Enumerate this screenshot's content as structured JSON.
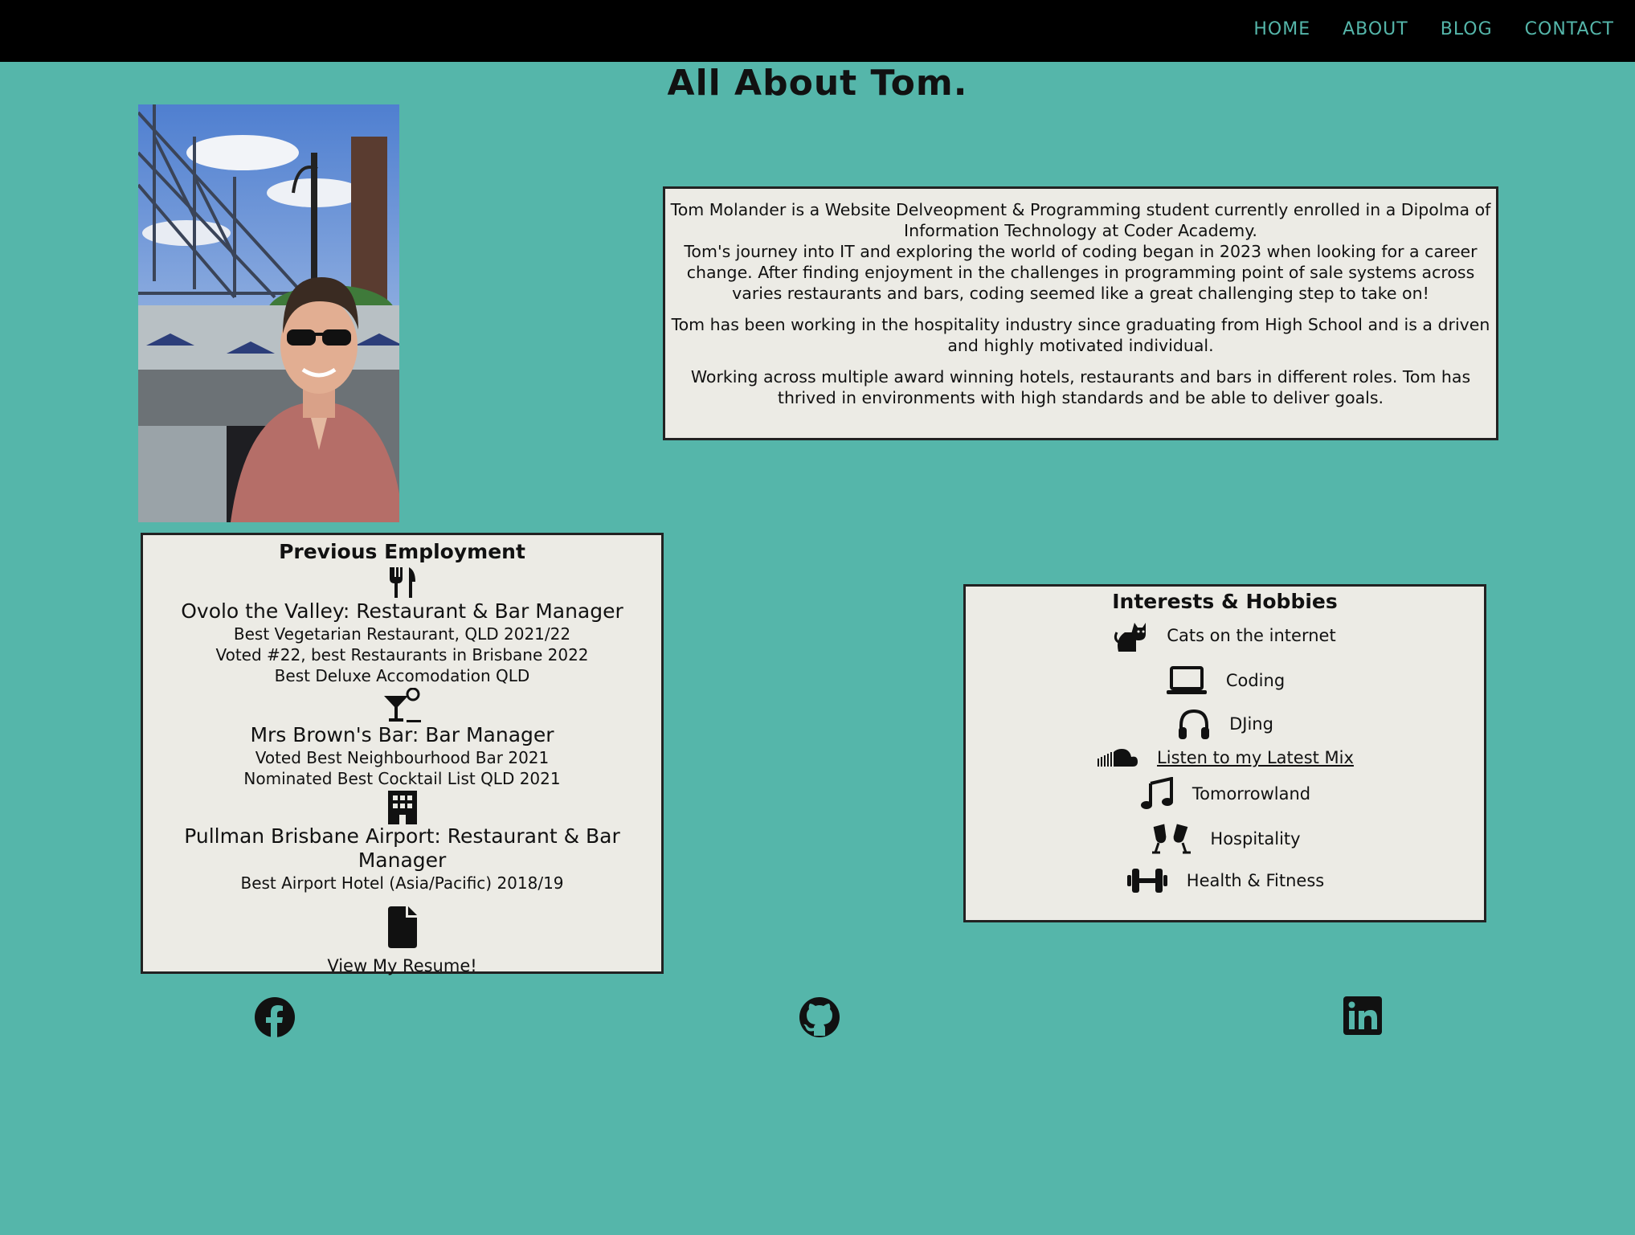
{
  "nav": {
    "links": [
      "HOME",
      "ABOUT",
      "BLOG",
      "CONTACT"
    ]
  },
  "page": {
    "title": "All About Tom."
  },
  "about": {
    "paragraph_1": "Tom Molander is a Website Delveopment & Programming student currently enrolled in a Dipolma of Information Technology at Coder Academy.",
    "paragraph_2": "Tom's journey into IT and exploring the world of coding began in 2023 when looking for a career change. After finding enjoyment in the challenges in programming point of sale systems across varies restaurants and bars, coding seemed like a great challenging step to take on!",
    "paragraph_3": "Tom has been working in the hospitality industry since graduating from High School and is a driven and highly motivated individual.",
    "paragraph_4": "Working across multiple award winning hotels, restaurants and bars in different roles. Tom has thrived in environments with high standards and be able to deliver goals."
  },
  "employment": {
    "heading": "Previous Employment",
    "jobs": [
      {
        "icon": "utensils-icon",
        "title": "Ovolo the Valley: Restaurant & Bar Manager",
        "awards": [
          "Best Vegetarian Restaurant, QLD 2021/22",
          "Voted #22, best Restaurants in Brisbane 2022",
          "Best Deluxe Accomodation QLD"
        ]
      },
      {
        "icon": "cocktail-icon",
        "title": "Mrs Brown's Bar: Bar Manager",
        "awards": [
          "Voted Best Neighbourhood Bar 2021",
          "Nominated Best Cocktail List QLD 2021"
        ]
      },
      {
        "icon": "hotel-icon",
        "title": "Pullman Brisbane Airport: Restaurant & Bar Manager",
        "awards": [
          "Best Airport Hotel (Asia/Pacific) 2018/19"
        ]
      }
    ],
    "resume_label": "View My Resume!"
  },
  "interests": {
    "heading": "Interests & Hobbies",
    "items": [
      {
        "icon": "cat-icon",
        "label": "Cats on the internet"
      },
      {
        "icon": "laptop-icon",
        "label": "Coding"
      },
      {
        "icon": "headphones-icon",
        "label": "DJing"
      },
      {
        "icon": "soundcloud-icon",
        "label": "Listen to my Latest Mix"
      },
      {
        "icon": "music-note-icon",
        "label": "Tomorrowland"
      },
      {
        "icon": "glasses-cheers-icon",
        "label": "Hospitality"
      },
      {
        "icon": "dumbbell-icon",
        "label": "Health & Fitness"
      }
    ]
  },
  "social": {
    "icons": [
      "facebook-icon",
      "github-icon",
      "linkedin-icon"
    ]
  },
  "colors": {
    "page_background": "#55b6aa",
    "navbar_background": "#000000",
    "nav_link": "#55b6aa",
    "panel_background": "#ecebe5"
  }
}
